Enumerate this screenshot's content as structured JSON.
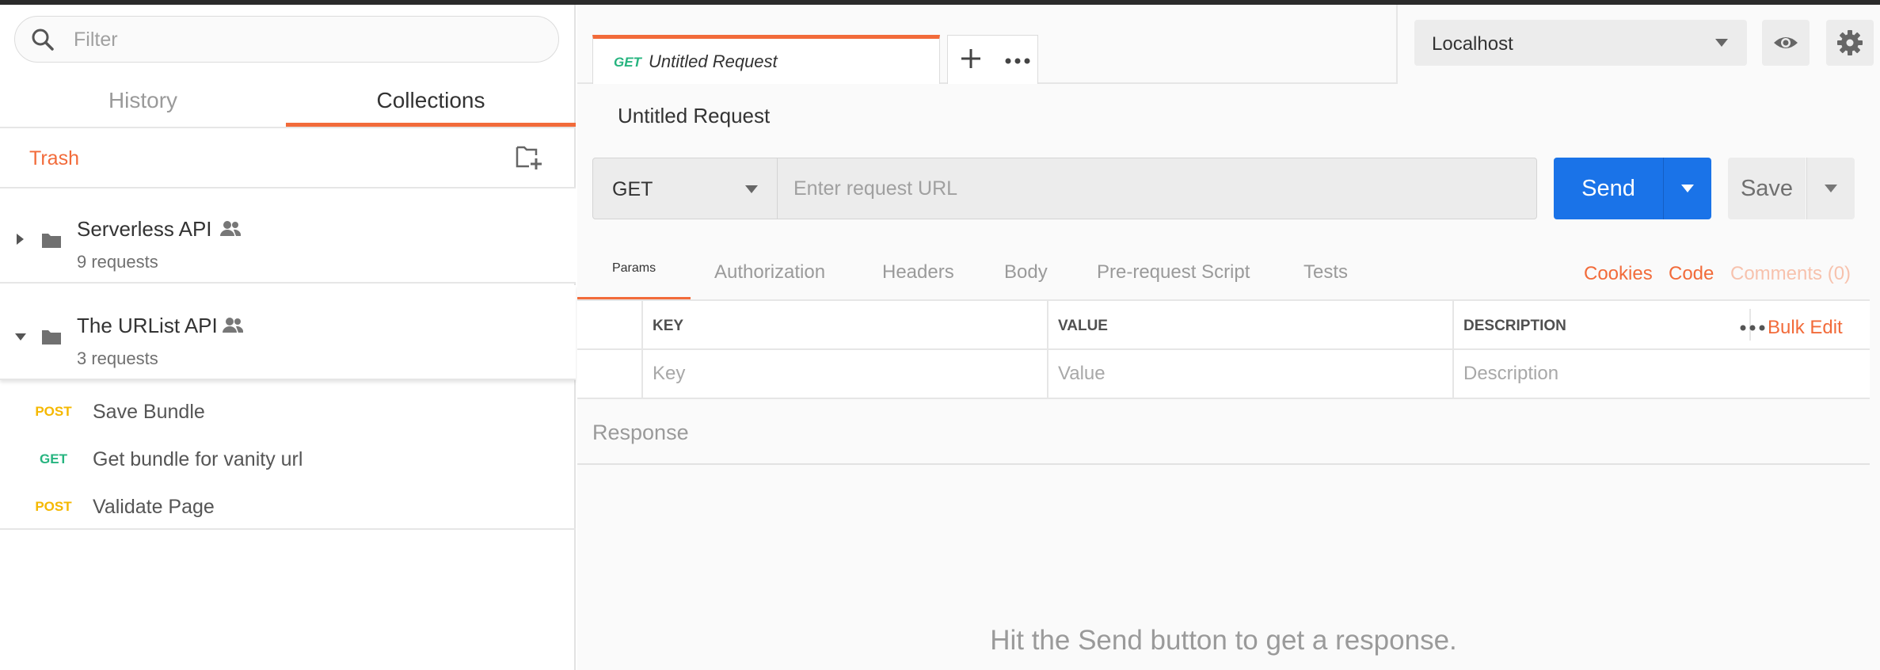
{
  "sidebar": {
    "filter_placeholder": "Filter",
    "tabs": {
      "history": "History",
      "collections": "Collections"
    },
    "trash_label": "Trash",
    "collections": [
      {
        "name": "Serverless API",
        "count": "9 requests",
        "expanded": false
      },
      {
        "name": "The URList API",
        "count": "3 requests",
        "expanded": true
      }
    ],
    "requests": [
      {
        "method": "POST",
        "name": "Save Bundle"
      },
      {
        "method": "GET",
        "name": "Get bundle for vanity url"
      },
      {
        "method": "POST",
        "name": "Validate Page"
      }
    ]
  },
  "tabs": {
    "active": {
      "method": "GET",
      "title": "Untitled Request"
    }
  },
  "environment": {
    "selected": "Localhost"
  },
  "request": {
    "title": "Untitled Request",
    "method": "GET",
    "url_placeholder": "Enter request URL",
    "send_label": "Send",
    "save_label": "Save"
  },
  "request_tabs": [
    "Params",
    "Authorization",
    "Headers",
    "Body",
    "Pre-request Script",
    "Tests"
  ],
  "request_links": {
    "cookies": "Cookies",
    "code": "Code",
    "comments": "Comments (0)"
  },
  "params": {
    "headers": {
      "key": "KEY",
      "value": "VALUE",
      "description": "DESCRIPTION"
    },
    "placeholders": {
      "key": "Key",
      "value": "Value",
      "description": "Description"
    },
    "bulk_edit": "Bulk Edit"
  },
  "response": {
    "label": "Response",
    "empty_message": "Hit the Send button to get a response."
  },
  "colors": {
    "accent": "#f26b3a",
    "send_blue": "#1a73e8",
    "get_green": "#26b47f",
    "post_yellow": "#f5b800"
  }
}
